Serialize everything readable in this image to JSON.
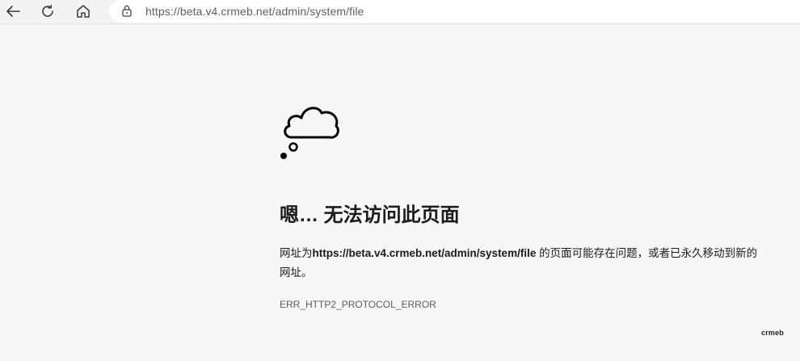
{
  "browser": {
    "url": "https://beta.v4.crmeb.net/admin/system/file",
    "icons": {
      "back": "back-arrow-icon",
      "refresh": "refresh-icon",
      "home": "home-icon",
      "lock": "lock-icon"
    }
  },
  "error_page": {
    "icon": "thought-cloud-icon",
    "heading": "嗯… 无法访问此页面",
    "desc_prefix": "网址为",
    "desc_url": "https://beta.v4.crmeb.net/admin/system/file",
    "desc_suffix": " 的页面可能存在问题，或者已永久移动到新的网址。",
    "error_code": "ERR_HTTP2_PROTOCOL_ERROR"
  },
  "brand": {
    "text": "crmeb"
  }
}
